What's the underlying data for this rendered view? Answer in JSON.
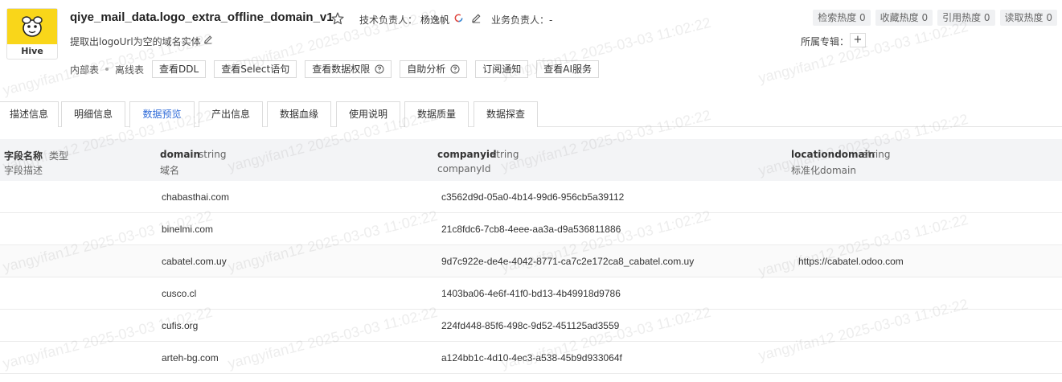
{
  "header": {
    "logo_label": "Hive",
    "title": "qiye_mail_data.logo_extra_offline_domain_v1",
    "tech_owner_label": "技术负责人：",
    "tech_owner_name": "杨逸帆",
    "biz_owner_label": "业务负责人：-",
    "subtitle": "提取出logoUrl为空的域名实体",
    "column_label": "所属专辑：",
    "add_label": "+",
    "heat_badges": [
      {
        "label": "检索热度 0"
      },
      {
        "label": "收藏热度 0"
      },
      {
        "label": "引用热度 0"
      },
      {
        "label": "读取热度 0"
      }
    ]
  },
  "meta": {
    "inner_table": "内部表",
    "offline_table": "离线表",
    "buttons": {
      "ddl": "查看DDL",
      "select": "查看Select语句",
      "permission": "查看数据权限",
      "auto_analysis": "自助分析",
      "subscribe": "订阅通知",
      "ai_service": "查看AI服务"
    }
  },
  "tabs": [
    {
      "label": "描述信息"
    },
    {
      "label": "明细信息"
    },
    {
      "label": "数据预览"
    },
    {
      "label": "产出信息"
    },
    {
      "label": "数据血缘"
    },
    {
      "label": "使用说明"
    },
    {
      "label": "数据质量"
    },
    {
      "label": "数据探查"
    }
  ],
  "active_tab": "数据预览",
  "table": {
    "header_first": {
      "name": "字段名称",
      "type": "类型",
      "desc": "字段描述"
    },
    "columns": [
      {
        "name": "domain",
        "type": "string",
        "desc": "域名"
      },
      {
        "name": "companyid",
        "type": "string",
        "desc": "companyId"
      },
      {
        "name": "locationdomain",
        "type": "string",
        "desc": "标准化domain"
      }
    ],
    "rows": [
      {
        "domain": "chabasthai.com",
        "companyid": "c3562d9d-05a0-4b14-99d6-956cb5a39112",
        "locationdomain": ""
      },
      {
        "domain": "binelmi.com",
        "companyid": "21c8fdc6-7cb8-4eee-aa3a-d9a536811886",
        "locationdomain": ""
      },
      {
        "domain": "cabatel.com.uy",
        "companyid": "9d7c922e-de4e-4042-8771-ca7c2e172ca8_cabatel.com.uy",
        "locationdomain": "https://cabatel.odoo.com"
      },
      {
        "domain": "cusco.cl",
        "companyid": "1403ba06-4e6f-41f0-bd13-4b49918d9786",
        "locationdomain": ""
      },
      {
        "domain": "cufis.org",
        "companyid": "224fd448-85f6-498c-9d52-451125ad3559",
        "locationdomain": ""
      },
      {
        "domain": "arteh-bg.com",
        "companyid": "a124bb1c-4d10-4ec3-a538-45b9d933064f",
        "locationdomain": ""
      }
    ]
  },
  "watermark": "yangyifan12 2025-03-03 11:02:22",
  "colors": {
    "accent": "#2f6bd8",
    "logo_bg": "#f9d61a"
  }
}
